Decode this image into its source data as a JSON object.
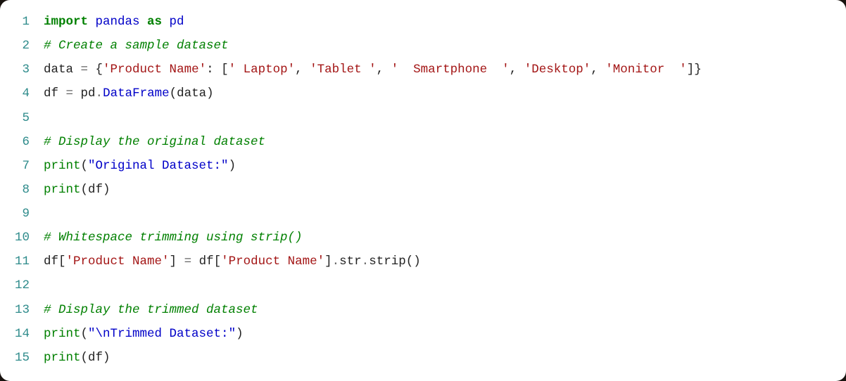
{
  "lines": {
    "1": {
      "num": "1",
      "t1": "import",
      "t2": " pandas ",
      "t3": "as",
      "t4": " pd"
    },
    "2": {
      "num": "2",
      "cmt": "# Create a sample dataset"
    },
    "3": {
      "num": "3",
      "t1": "data ",
      "t2": "=",
      "t3": " {",
      "t4": "'Product Name'",
      "t5": ": [",
      "t6": "' Laptop'",
      "t7": ", ",
      "t8": "'Tablet '",
      "t9": ", ",
      "t10": "'  Smartphone  '",
      "t11": ", ",
      "t12": "'Desktop'",
      "t13": ", ",
      "t14": "'Monitor  '",
      "t15": "]}"
    },
    "4": {
      "num": "4",
      "t1": "df ",
      "t2": "=",
      "t3": " pd",
      "t4": ".",
      "t5": "DataFrame",
      "t6": "(data)"
    },
    "5": {
      "num": "5"
    },
    "6": {
      "num": "6",
      "cmt": "# Display the original dataset"
    },
    "7": {
      "num": "7",
      "t1": "print",
      "t2": "(",
      "t3": "\"Original Dataset:\"",
      "t4": ")"
    },
    "8": {
      "num": "8",
      "t1": "print",
      "t2": "(df)"
    },
    "9": {
      "num": "9"
    },
    "10": {
      "num": "10",
      "cmt": "# Whitespace trimming using strip()"
    },
    "11": {
      "num": "11",
      "t1": "df[",
      "t2": "'Product Name'",
      "t3": "] ",
      "t4": "=",
      "t5": " df[",
      "t6": "'Product Name'",
      "t7": "]",
      "t8": ".",
      "t9": "str",
      "t10": ".",
      "t11": "strip()"
    },
    "12": {
      "num": "12"
    },
    "13": {
      "num": "13",
      "cmt": "# Display the trimmed dataset"
    },
    "14": {
      "num": "14",
      "t1": "print",
      "t2": "(",
      "t3": "\"\\nTrimmed Dataset:\"",
      "t4": ")"
    },
    "15": {
      "num": "15",
      "t1": "print",
      "t2": "(df)"
    }
  }
}
